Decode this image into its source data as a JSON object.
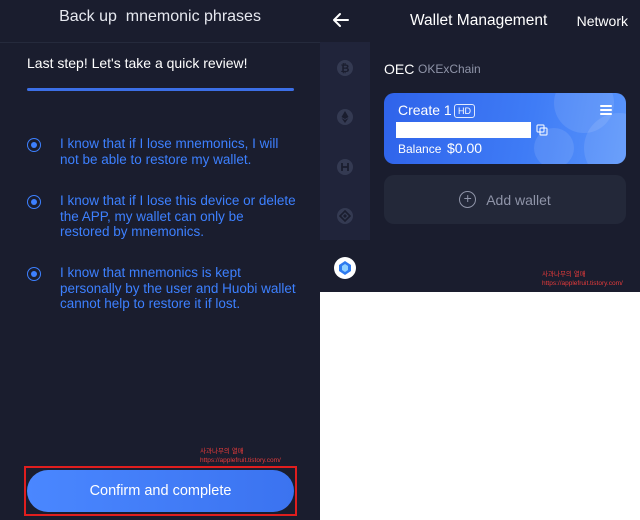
{
  "left": {
    "title": "Back up  mnemonic phrases",
    "subtitle": "Last step! Let's take a quick review!",
    "checks": [
      {
        "text": "I know that if I lose mnemonics, I will not be able to restore my wallet.",
        "checked": true
      },
      {
        "text": "I know that if I lose this device or delete the APP, my wallet can only be restored by mnemonics.",
        "checked": true
      },
      {
        "text": "I know that mnemonics is kept personally by the user and Huobi wallet cannot help to restore it if lost.",
        "checked": true
      }
    ],
    "confirm_label": "Confirm and complete",
    "watermark": {
      "line1": "사과나무의 열매",
      "line2": "https://applefruit.tistory.com/"
    }
  },
  "right": {
    "header": {
      "title": "Wallet Management",
      "network": "Network"
    },
    "chains": [
      "bitcoin-icon",
      "ethereum-icon",
      "heco-icon",
      "bsc-icon",
      "oec-icon"
    ],
    "selected_chain": {
      "short": "OEC",
      "full": "OKExChain"
    },
    "wallet": {
      "name": "Create 1",
      "badge": "HD",
      "balance_label": "Balance",
      "balance": "$0.00"
    },
    "add_wallet_label": "Add wallet",
    "watermark": {
      "line1": "사과나무의 열매",
      "line2": "https://applefruit.tistory.com/"
    }
  },
  "colors": {
    "background": "#1a1d2e",
    "accent": "#3d80ff",
    "card_gradient_start": "#2f63ea",
    "card_gradient_end": "#5a95fb",
    "highlight_border": "#e01e1e"
  }
}
